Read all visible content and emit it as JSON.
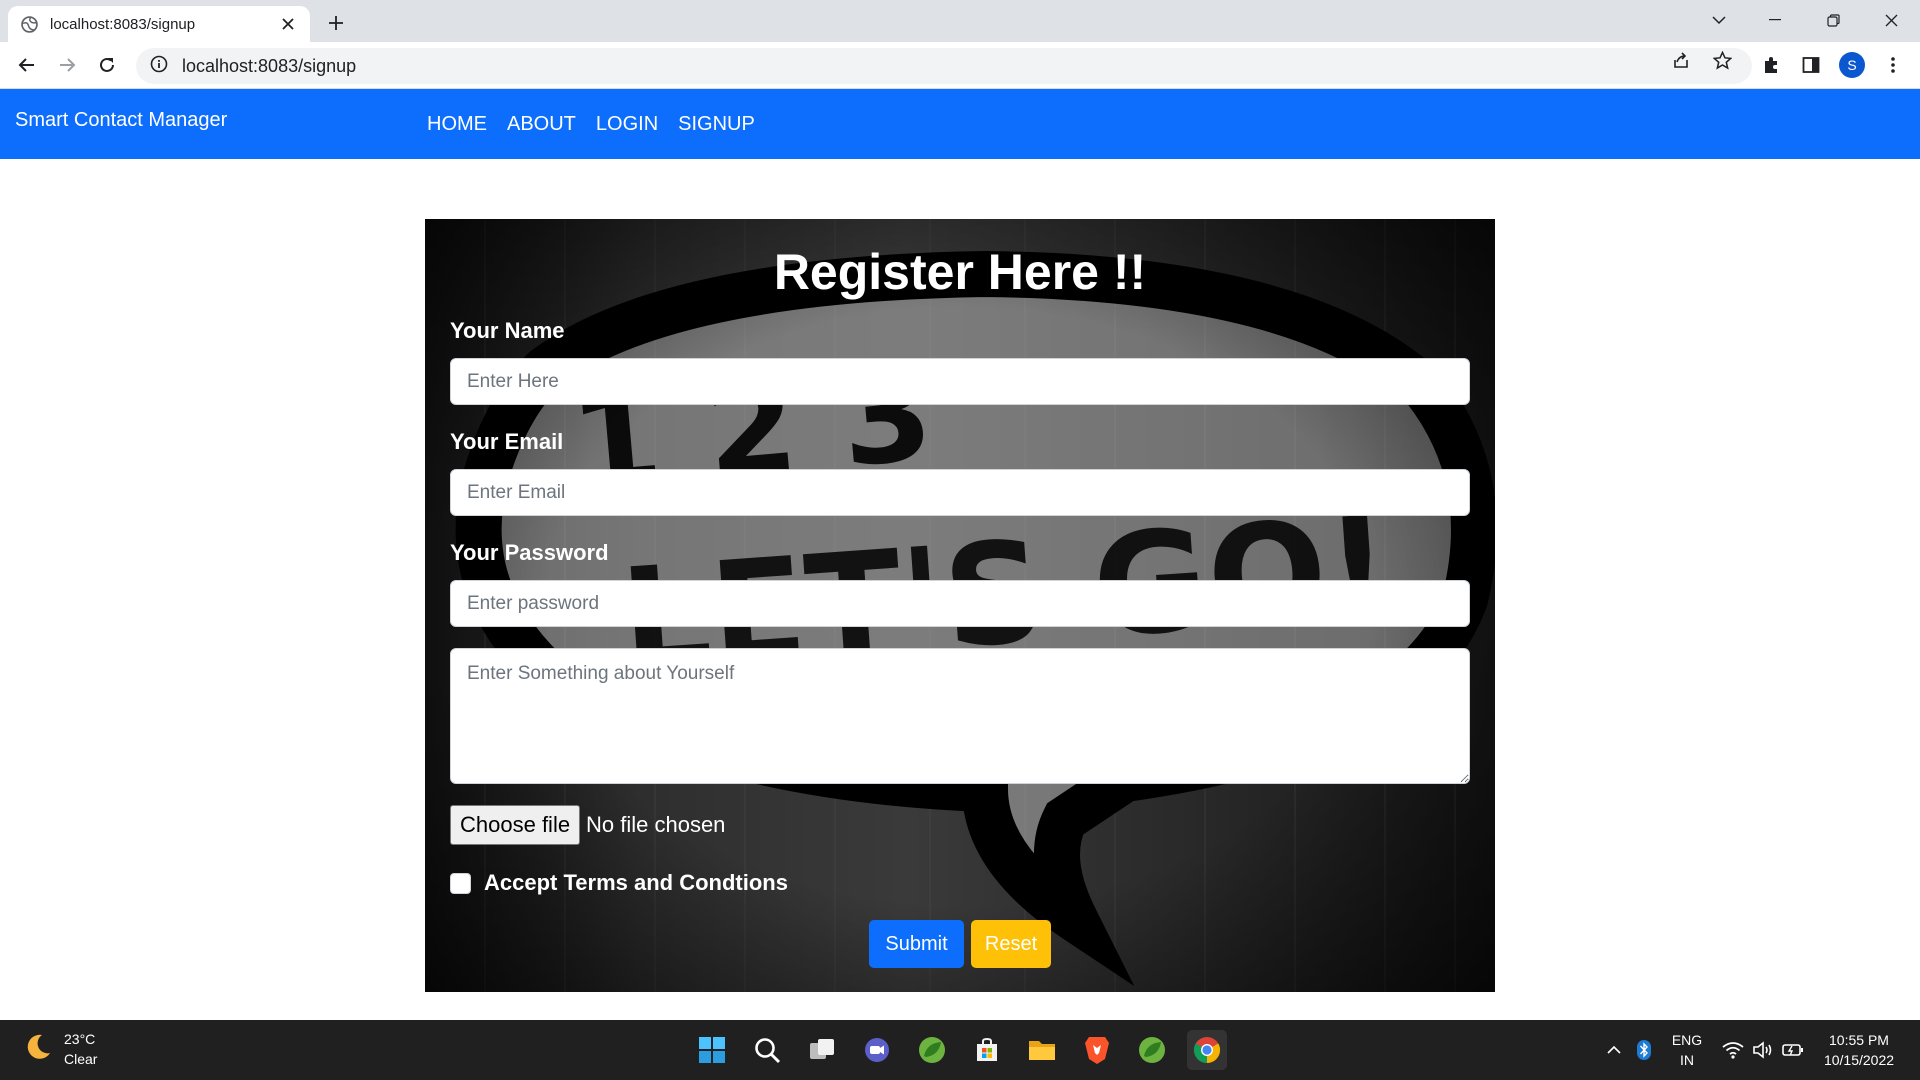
{
  "browser": {
    "tab_title": "localhost:8083/signup",
    "tab_close": "✕",
    "new_tab": "+",
    "url": "localhost:8083/signup",
    "profile_initial": "S"
  },
  "navbar": {
    "brand": "Smart Contact Manager",
    "links": [
      "HOME",
      "ABOUT",
      "LOGIN",
      "SIGNUP"
    ]
  },
  "form": {
    "title": "Register Here !!",
    "name_label": "Your Name",
    "name_placeholder": "Enter Here",
    "email_label": "Your Email",
    "email_placeholder": "Enter Email",
    "password_label": "Your Password",
    "password_placeholder": "Enter password",
    "about_placeholder": "Enter Something about Yourself",
    "file_button": "Choose file",
    "file_status": "No file chosen",
    "terms_label": "Accept Terms and Condtions",
    "terms_checked": false,
    "submit_label": "Submit",
    "reset_label": "Reset"
  },
  "taskbar": {
    "weather_temp": "23°C",
    "weather_desc": "Clear",
    "lang_top": "ENG",
    "lang_bottom": "IN",
    "time": "10:55 PM",
    "date": "10/15/2022",
    "apps": [
      "start-icon",
      "search-icon",
      "task-view-icon",
      "meet-icon",
      "spring-tools-icon",
      "store-icon",
      "file-explorer-icon",
      "brave-icon",
      "spring-tools-icon",
      "chrome-icon"
    ]
  },
  "colors": {
    "navbar": "#0d6efd",
    "submit": "#0d6efd",
    "reset": "#ffc107",
    "taskbar": "#202020"
  }
}
